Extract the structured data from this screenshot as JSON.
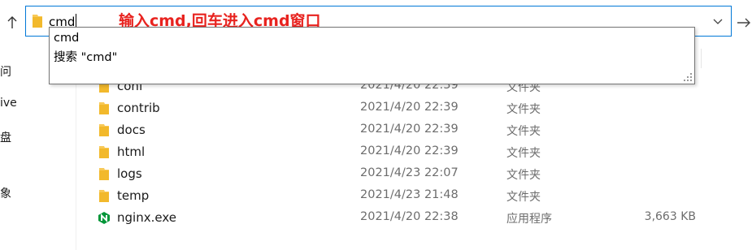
{
  "address_bar": {
    "value": "cmd",
    "annotation": "输入cmd,回车进入cmd窗口"
  },
  "suggestions": [
    {
      "label": "cmd"
    },
    {
      "label": "搜索 \"cmd\""
    }
  ],
  "nav": {
    "items": [
      {
        "label": "问"
      },
      {
        "label": "ive"
      },
      {
        "label": "盘"
      },
      {
        "label": "象"
      }
    ]
  },
  "files": [
    {
      "name": "conf",
      "date": "2021/4/20 22:39",
      "type": "文件夹",
      "size": "",
      "icon": "folder-icon"
    },
    {
      "name": "contrib",
      "date": "2021/4/20 22:39",
      "type": "文件夹",
      "size": "",
      "icon": "folder-icon"
    },
    {
      "name": "docs",
      "date": "2021/4/20 22:39",
      "type": "文件夹",
      "size": "",
      "icon": "folder-icon"
    },
    {
      "name": "html",
      "date": "2021/4/20 22:39",
      "type": "文件夹",
      "size": "",
      "icon": "folder-icon"
    },
    {
      "name": "logs",
      "date": "2021/4/23 22:07",
      "type": "文件夹",
      "size": "",
      "icon": "folder-icon"
    },
    {
      "name": "temp",
      "date": "2021/4/23 21:48",
      "type": "文件夹",
      "size": "",
      "icon": "folder-icon"
    },
    {
      "name": "nginx.exe",
      "date": "2021/4/20 22:38",
      "type": "应用程序",
      "size": "3,663 KB",
      "icon": "nginx-app-icon"
    }
  ],
  "colors": {
    "accent": "#0078d7",
    "annotation": "#e8231f",
    "folder": "#f8c957",
    "nginx": "#009639"
  }
}
